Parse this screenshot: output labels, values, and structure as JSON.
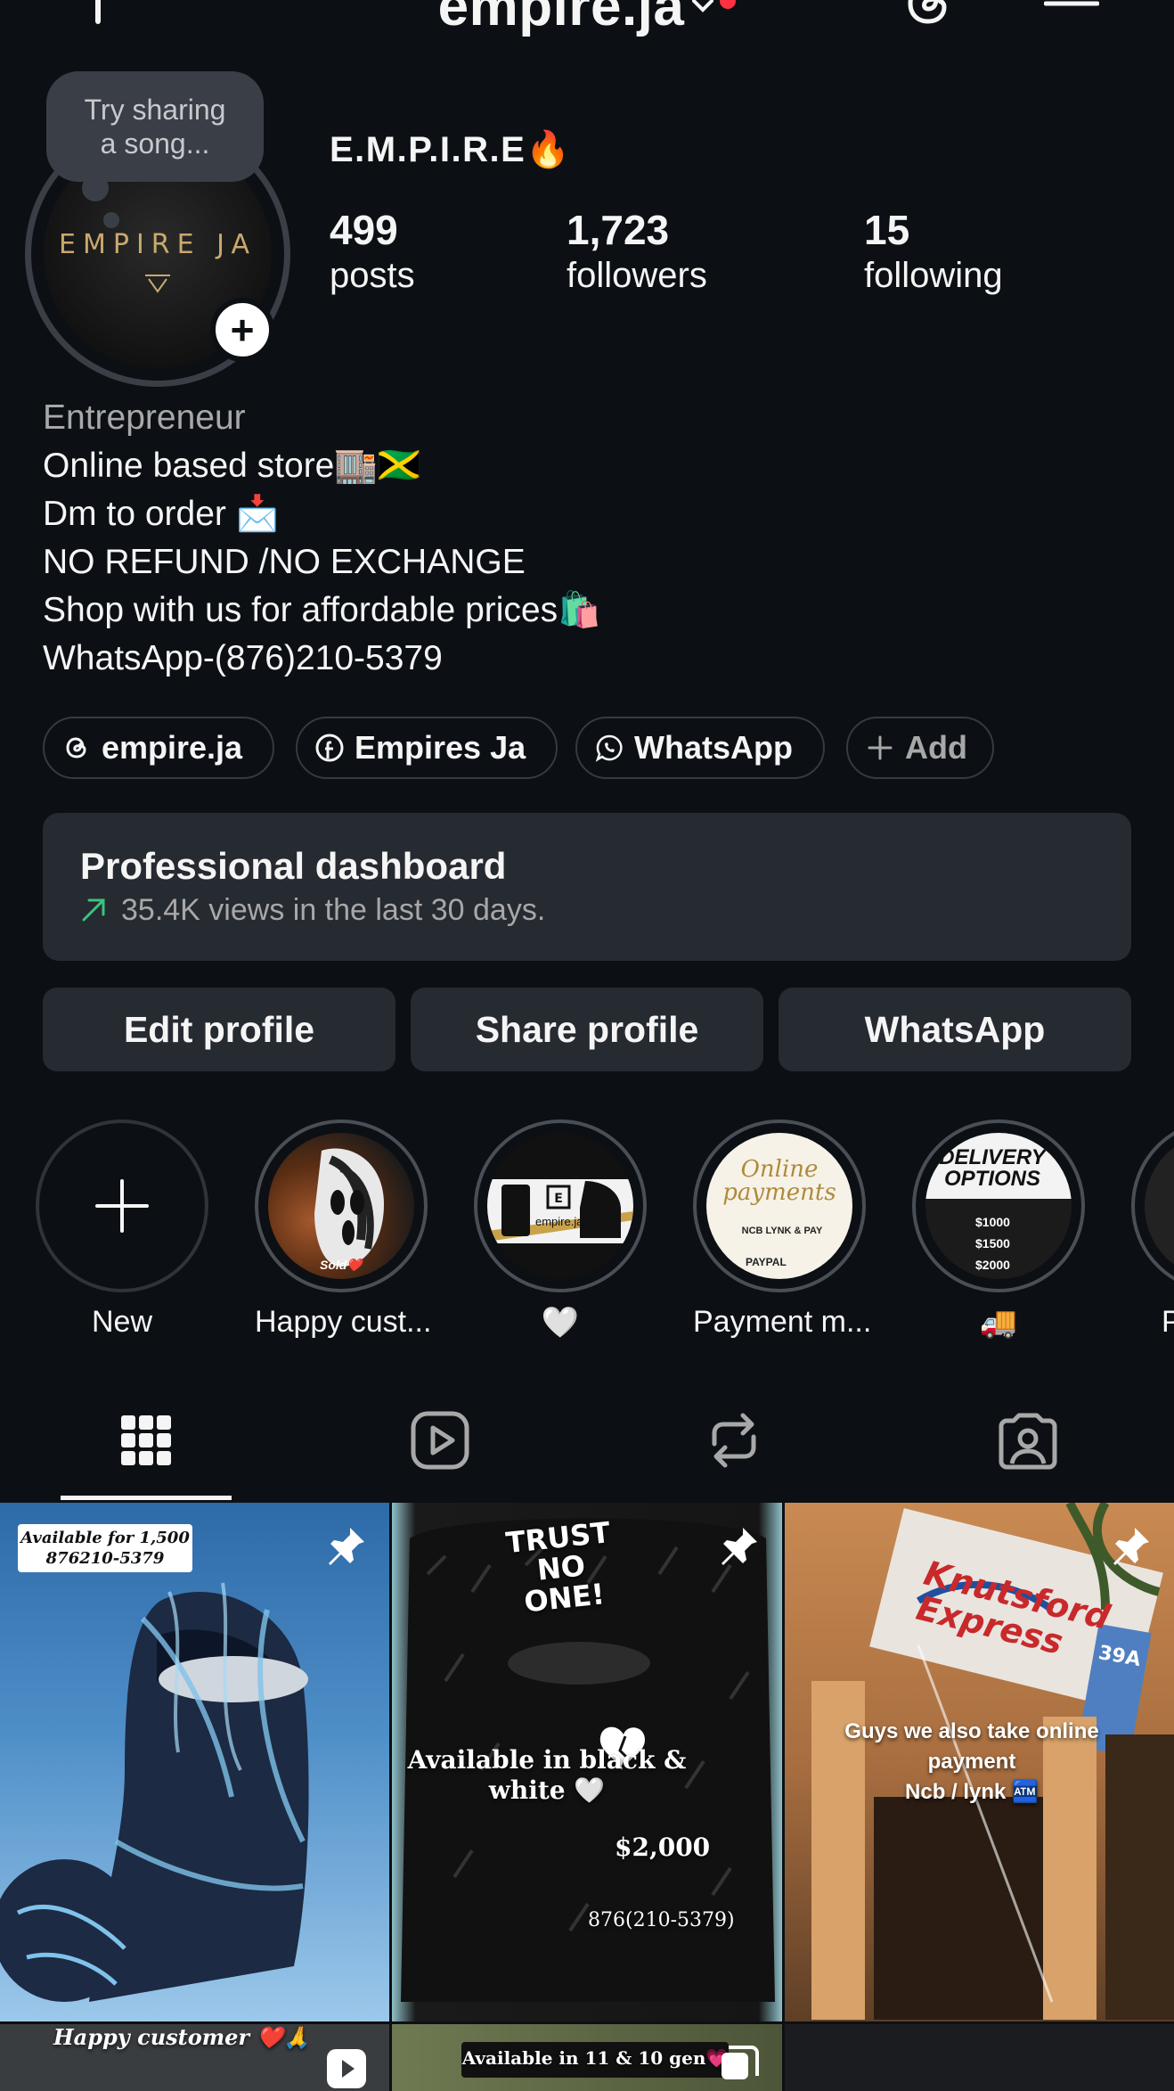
{
  "header": {
    "username": "empire.ja",
    "create_icon": "plus-icon",
    "threads_icon": "threads-icon",
    "menu_icon": "hamburger-menu-icon"
  },
  "profile": {
    "note": "Try sharing a song...",
    "avatar_text": "EMPIRE JA",
    "display_name": "E.M.P.I.R.E🔥",
    "stats": [
      {
        "value": "499",
        "label": "posts"
      },
      {
        "value": "1,723",
        "label": "followers"
      },
      {
        "value": "15",
        "label": "following"
      }
    ],
    "category": "Entrepreneur",
    "bio_lines": [
      "Online based store🏬🇯🇲",
      "Dm to order 📩",
      "NO REFUND /NO EXCHANGE",
      "Shop with us for affordable prices🛍️",
      "WhatsApp-(876)210-5379"
    ]
  },
  "links": [
    {
      "label": "empire.ja",
      "icon": "threads-icon"
    },
    {
      "label": "Empires Ja",
      "icon": "facebook-icon"
    },
    {
      "label": "WhatsApp",
      "icon": "whatsapp-icon"
    },
    {
      "label": "Add",
      "icon": "plus-icon"
    }
  ],
  "dashboard": {
    "title": "Professional dashboard",
    "subtitle": "35.4K views in the last 30 days.",
    "accent": "#3ac47d"
  },
  "actions": {
    "edit": "Edit profile",
    "share": "Share profile",
    "whatsapp": "WhatsApp"
  },
  "highlights": [
    {
      "label": "New"
    },
    {
      "label": "Happy cust..."
    },
    {
      "label": "🤍"
    },
    {
      "label": "Payment m..."
    },
    {
      "label": "🚚"
    },
    {
      "label": "P"
    }
  ],
  "highlight_images": {
    "payment_title": "Online payments",
    "payment_sub": "NCB LYNK & PAY",
    "payment_paypal": "PAYPAL",
    "delivery_title": "DELIVERY OPTIONS",
    "delivery_prices": [
      "$1000",
      "$1500",
      "$2000"
    ],
    "white_brand": "empire.ja",
    "sold_tag": "Sold❤️"
  },
  "tabs": [
    "grid-icon",
    "reels-icon",
    "reposts-icon",
    "tagged-icon"
  ],
  "posts": [
    {
      "caption": "Available for 1,500\n876210-5379"
    },
    {
      "caption_top": "TRUST NO ONE!",
      "caption_mid": "Available in black & white 🤍",
      "price": "$2,000",
      "phone": "876(210-5379)"
    },
    {
      "caption": "Guys we also take online payment\nNcb / lynk 🏧",
      "sign": "Knutsford Express",
      "sign_depot": "39A"
    },
    {
      "caption": "Happy customer ❤️🙏"
    },
    {
      "caption": "Available in 11 & 10 gen💗"
    }
  ],
  "colors": {
    "background": "#0c1014",
    "surface": "#262a31",
    "text": "#f5f5f5",
    "muted": "#a8a8a8",
    "notification": "#ff3040"
  }
}
